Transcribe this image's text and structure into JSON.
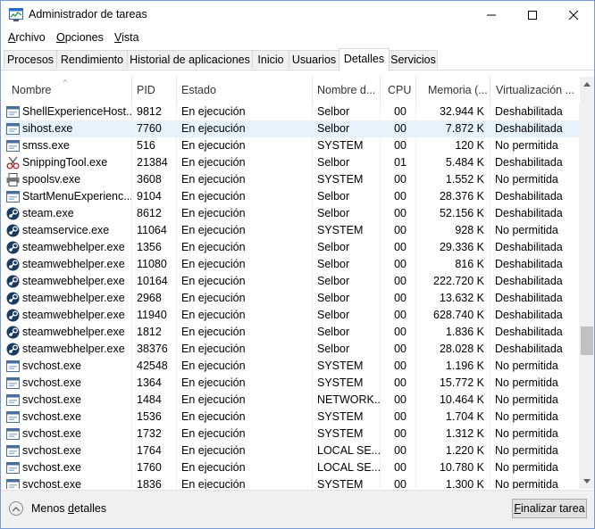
{
  "window": {
    "title": "Administrador de tareas"
  },
  "menu": {
    "items": [
      {
        "accel": "A",
        "rest": "rchivo"
      },
      {
        "accel": "O",
        "rest": "pciones"
      },
      {
        "accel": "V",
        "rest": "ista"
      }
    ]
  },
  "tabs": [
    {
      "label": "Procesos"
    },
    {
      "label": "Rendimiento"
    },
    {
      "label": "Historial de aplicaciones"
    },
    {
      "label": "Inicio"
    },
    {
      "label": "Usuarios"
    },
    {
      "label": "Detalles",
      "active": true
    },
    {
      "label": "Servicios"
    }
  ],
  "table": {
    "columns": [
      {
        "label": "Nombre"
      },
      {
        "label": "PID"
      },
      {
        "label": "Estado"
      },
      {
        "label": "Nombre d..."
      },
      {
        "label": "CPU"
      },
      {
        "label": "Memoria (..."
      },
      {
        "label": "Virtualización ..."
      }
    ],
    "sort_indicator": "^",
    "rows": [
      {
        "icon": "window",
        "name": "ShellExperienceHost....",
        "pid": "9812",
        "status": "En ejecución",
        "user": "Selbor",
        "cpu": "00",
        "memory": "32.944 K",
        "virt": "Deshabilitada"
      },
      {
        "icon": "window",
        "name": "sihost.exe",
        "pid": "7760",
        "status": "En ejecución",
        "user": "Selbor",
        "cpu": "00",
        "memory": "7.872 K",
        "virt": "Deshabilitada",
        "selected": true
      },
      {
        "icon": "window",
        "name": "smss.exe",
        "pid": "516",
        "status": "En ejecución",
        "user": "SYSTEM",
        "cpu": "00",
        "memory": "120 K",
        "virt": "No permitida"
      },
      {
        "icon": "snipping",
        "name": "SnippingTool.exe",
        "pid": "21384",
        "status": "En ejecución",
        "user": "Selbor",
        "cpu": "01",
        "memory": "5.484 K",
        "virt": "Deshabilitada"
      },
      {
        "icon": "printer",
        "name": "spoolsv.exe",
        "pid": "3608",
        "status": "En ejecución",
        "user": "SYSTEM",
        "cpu": "00",
        "memory": "1.552 K",
        "virt": "No permitida"
      },
      {
        "icon": "window",
        "name": "StartMenuExperienc...",
        "pid": "9104",
        "status": "En ejecución",
        "user": "Selbor",
        "cpu": "00",
        "memory": "28.376 K",
        "virt": "Deshabilitada"
      },
      {
        "icon": "steam",
        "name": "steam.exe",
        "pid": "8612",
        "status": "En ejecución",
        "user": "Selbor",
        "cpu": "00",
        "memory": "52.156 K",
        "virt": "Deshabilitada"
      },
      {
        "icon": "steam",
        "name": "steamservice.exe",
        "pid": "11064",
        "status": "En ejecución",
        "user": "SYSTEM",
        "cpu": "00",
        "memory": "928 K",
        "virt": "No permitida"
      },
      {
        "icon": "steam",
        "name": "steamwebhelper.exe",
        "pid": "1356",
        "status": "En ejecución",
        "user": "Selbor",
        "cpu": "00",
        "memory": "29.336 K",
        "virt": "Deshabilitada"
      },
      {
        "icon": "steam",
        "name": "steamwebhelper.exe",
        "pid": "11080",
        "status": "En ejecución",
        "user": "Selbor",
        "cpu": "00",
        "memory": "816 K",
        "virt": "Deshabilitada"
      },
      {
        "icon": "steam",
        "name": "steamwebhelper.exe",
        "pid": "10164",
        "status": "En ejecución",
        "user": "Selbor",
        "cpu": "00",
        "memory": "222.720 K",
        "virt": "Deshabilitada"
      },
      {
        "icon": "steam",
        "name": "steamwebhelper.exe",
        "pid": "2968",
        "status": "En ejecución",
        "user": "Selbor",
        "cpu": "00",
        "memory": "13.632 K",
        "virt": "Deshabilitada"
      },
      {
        "icon": "steam",
        "name": "steamwebhelper.exe",
        "pid": "11940",
        "status": "En ejecución",
        "user": "Selbor",
        "cpu": "00",
        "memory": "628.740 K",
        "virt": "Deshabilitada"
      },
      {
        "icon": "steam",
        "name": "steamwebhelper.exe",
        "pid": "1812",
        "status": "En ejecución",
        "user": "Selbor",
        "cpu": "00",
        "memory": "1.836 K",
        "virt": "Deshabilitada"
      },
      {
        "icon": "steam",
        "name": "steamwebhelper.exe",
        "pid": "38376",
        "status": "En ejecución",
        "user": "Selbor",
        "cpu": "00",
        "memory": "28.028 K",
        "virt": "Deshabilitada"
      },
      {
        "icon": "window",
        "name": "svchost.exe",
        "pid": "42548",
        "status": "En ejecución",
        "user": "SYSTEM",
        "cpu": "00",
        "memory": "1.196 K",
        "virt": "No permitida"
      },
      {
        "icon": "window",
        "name": "svchost.exe",
        "pid": "1364",
        "status": "En ejecución",
        "user": "SYSTEM",
        "cpu": "00",
        "memory": "15.772 K",
        "virt": "No permitida"
      },
      {
        "icon": "window",
        "name": "svchost.exe",
        "pid": "1484",
        "status": "En ejecución",
        "user": "NETWORK...",
        "cpu": "00",
        "memory": "10.464 K",
        "virt": "No permitida"
      },
      {
        "icon": "window",
        "name": "svchost.exe",
        "pid": "1536",
        "status": "En ejecución",
        "user": "SYSTEM",
        "cpu": "00",
        "memory": "1.704 K",
        "virt": "No permitida"
      },
      {
        "icon": "window",
        "name": "svchost.exe",
        "pid": "1732",
        "status": "En ejecución",
        "user": "SYSTEM",
        "cpu": "00",
        "memory": "1.312 K",
        "virt": "No permitida"
      },
      {
        "icon": "window",
        "name": "svchost.exe",
        "pid": "1764",
        "status": "En ejecución",
        "user": "LOCAL SE...",
        "cpu": "00",
        "memory": "1.220 K",
        "virt": "No permitida"
      },
      {
        "icon": "window",
        "name": "svchost.exe",
        "pid": "1760",
        "status": "En ejecución",
        "user": "LOCAL SE...",
        "cpu": "00",
        "memory": "10.780 K",
        "virt": "No permitida"
      },
      {
        "icon": "window",
        "name": "svchost.exe",
        "pid": "1836",
        "status": "En ejecución",
        "user": "SYSTEM",
        "cpu": "00",
        "memory": "1.300 K",
        "virt": "No permitida"
      }
    ]
  },
  "footer": {
    "fewer_details": {
      "prefix": "Menos ",
      "accel": "d",
      "rest": "etalles"
    },
    "end_task": {
      "prefix": "",
      "accel": "F",
      "rest": "inalizar tarea"
    }
  },
  "colors": {
    "selected_row": "#e5f1fb",
    "steam_blue": "#1b3a5f",
    "window_icon_blue": "#2a5b9c"
  }
}
